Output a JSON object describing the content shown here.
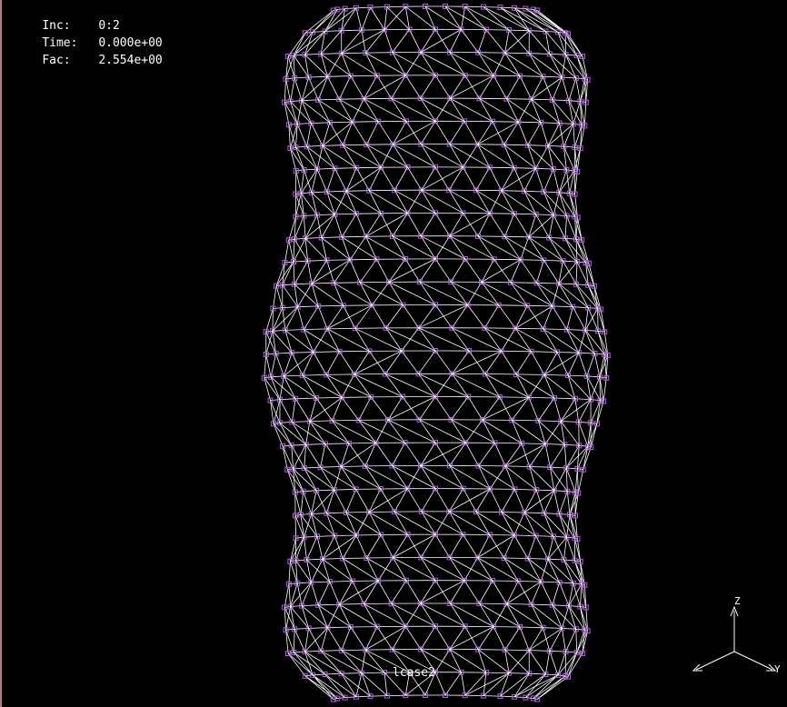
{
  "readouts": [
    {
      "key": "Inc:",
      "value": "0:2"
    },
    {
      "key": "Time:",
      "value": "0.000e+00"
    },
    {
      "key": "Fac:",
      "value": "2.554e+00"
    }
  ],
  "case_label": "lcase2",
  "axes": {
    "z": "Z",
    "y": "Y"
  },
  "colors": {
    "background": "#000000",
    "edges": "#ffffff",
    "nodes": "#b060e0"
  }
}
